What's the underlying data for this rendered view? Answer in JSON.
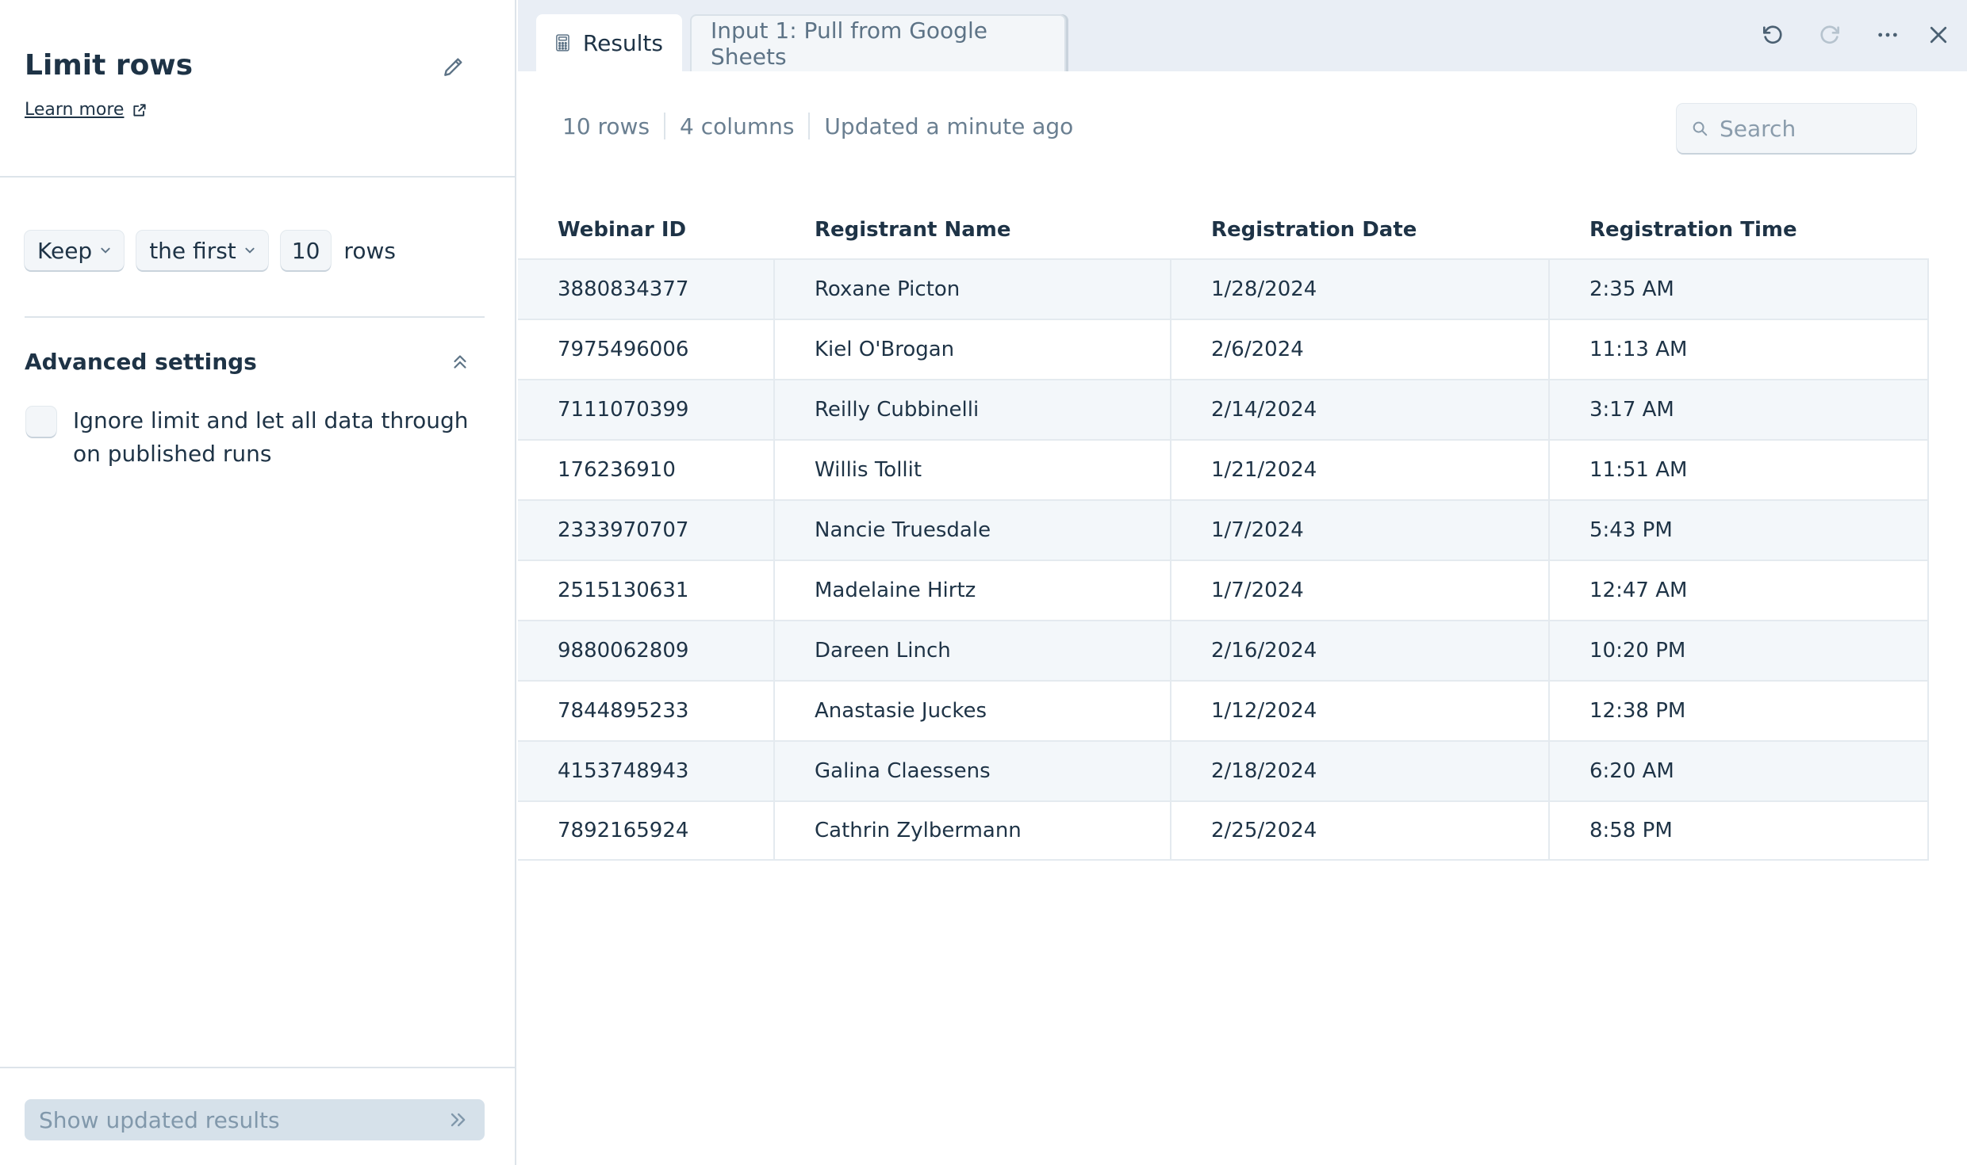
{
  "panel": {
    "title": "Limit rows",
    "learn_more": "Learn more",
    "mode": "Keep",
    "position": "the first",
    "count": "10",
    "unit": "rows",
    "advanced_title": "Advanced settings",
    "ignore_limit_label": "Ignore limit and let all data through on published runs",
    "ignore_limit_checked": false,
    "show_results": "Show updated results"
  },
  "tabs": {
    "results": "Results",
    "input": "Input 1: Pull from Google Sheets"
  },
  "summary": {
    "rows": "10 rows",
    "columns": "4 columns",
    "updated": "Updated a minute ago"
  },
  "search": {
    "placeholder": "Search"
  },
  "table": {
    "columns": [
      "Webinar ID",
      "Registrant Name",
      "Registration Date",
      "Registration Time"
    ],
    "rows": [
      [
        "3880834377",
        "Roxane Picton",
        "1/28/2024",
        "2:35 AM"
      ],
      [
        "7975496006",
        "Kiel O'Brogan",
        "2/6/2024",
        "11:13 AM"
      ],
      [
        "7111070399",
        "Reilly Cubbinelli",
        "2/14/2024",
        "3:17 AM"
      ],
      [
        "176236910",
        "Willis Tollit",
        "1/21/2024",
        "11:51 AM"
      ],
      [
        "2333970707",
        "Nancie Truesdale",
        "1/7/2024",
        "5:43 PM"
      ],
      [
        "2515130631",
        "Madelaine Hirtz",
        "1/7/2024",
        "12:47 AM"
      ],
      [
        "9880062809",
        "Dareen Linch",
        "2/16/2024",
        "10:20 PM"
      ],
      [
        "7844895233",
        "Anastasie Juckes",
        "1/12/2024",
        "12:38 PM"
      ],
      [
        "4153748943",
        "Galina Claessens",
        "2/18/2024",
        "6:20 AM"
      ],
      [
        "7892165924",
        "Cathrin Zylbermann",
        "2/25/2024",
        "8:58 PM"
      ]
    ]
  },
  "colors": {
    "text": "#1e3346",
    "muted": "#6a7f91",
    "tab_bar": "#e9eef5",
    "row_alt": "#f3f7fa",
    "button_disabled_bg": "#d6e1ea"
  }
}
